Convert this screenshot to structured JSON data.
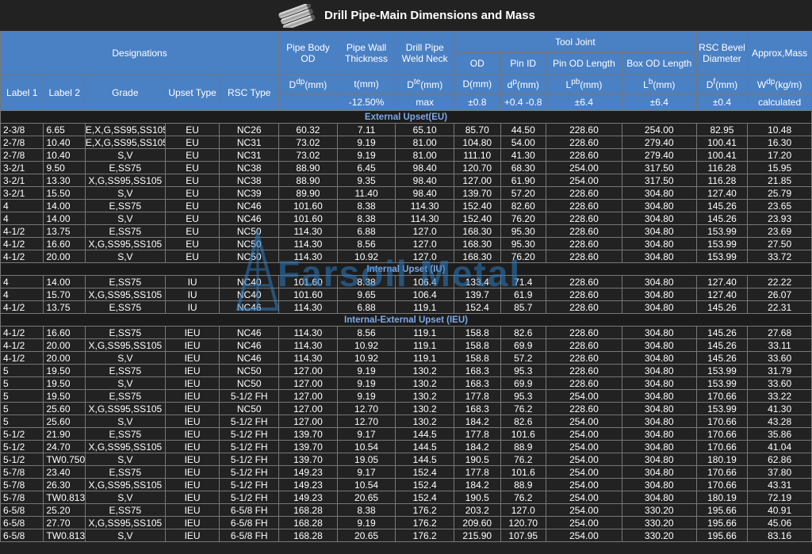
{
  "title": "Drill Pipe-Main Dimensions and Mass",
  "header": {
    "designations": "Designations",
    "pipe_body_od": "Pipe Body OD",
    "pipe_wall_thickness": "Pipe Wall Thickness",
    "drill_pipe_weld_neck": "Drill Pipe Weld Neck",
    "tool_joint": "Tool Joint",
    "rsc_bevel_diameter": "RSC Bevel Diameter",
    "approx_mass": "Approx,Mass",
    "od": "OD",
    "pin_id": "Pin ID",
    "pin_od_length": "Pin OD Length",
    "box_od_length": "Box OD Length",
    "label1": "Label 1",
    "label2": "Label 2",
    "grade": "Grade",
    "upset_type": "Upset Type",
    "rsc_type": "RSC Type",
    "u_ddp": "D<sup>dp</sup>(mm)",
    "u_t": "t(mm)",
    "u_dte": "D<sup>te</sup>(mm)",
    "u_d": "D(mm)",
    "u_dp": "d<sup>p</sup>(mm)",
    "u_lpb": "L<sup>pb</sup>(mm)",
    "u_lb": "L<sup>b</sup>(mm)",
    "u_df": "D<sup>f</sup>(mm)",
    "u_wdp": "W<sup>dp</sup>(kg/m)",
    "tol_t": "-12.50%",
    "tol_dte": "max",
    "tol_d": "±0.8",
    "tol_dp": "+0.4 -0.8",
    "tol_lpb": "±6.4",
    "tol_lb": "±6.4",
    "tol_df": "±0.4",
    "tol_w": "calculated"
  },
  "sections": [
    {
      "title": "External Upset(EU)",
      "rows": [
        [
          "2-3/8",
          "6.65",
          "E,X,G,SS95,SS105",
          "EU",
          "NC26",
          "60.32",
          "7.11",
          "65.10",
          "85.70",
          "44.50",
          "228.60",
          "254.00",
          "82.95",
          "10.48"
        ],
        [
          "2-7/8",
          "10.40",
          "E,X,G,SS95,SS105",
          "EU",
          "NC31",
          "73.02",
          "9.19",
          "81.00",
          "104.80",
          "54.00",
          "228.60",
          "279.40",
          "100.41",
          "16.30"
        ],
        [
          "2-7/8",
          "10.40",
          "S,V",
          "EU",
          "NC31",
          "73.02",
          "9.19",
          "81.00",
          "111.10",
          "41.30",
          "228.60",
          "279.40",
          "100.41",
          "17.20"
        ],
        [
          "3-2/1",
          "9.50",
          "E,SS75",
          "EU",
          "NC38",
          "88.90",
          "6.45",
          "98.40",
          "120.70",
          "68.30",
          "254.00",
          "317.50",
          "116.28",
          "15.95"
        ],
        [
          "3-2/1",
          "13.30",
          "X,G,SS95,SS105",
          "EU",
          "NC38",
          "88.90",
          "9.35",
          "98.40",
          "127.00",
          "61.90",
          "254.00",
          "317.50",
          "116.28",
          "21.85"
        ],
        [
          "3-2/1",
          "15.50",
          "S,V",
          "EU",
          "NC39",
          "89.90",
          "11.40",
          "98.40",
          "139.70",
          "57.20",
          "228.60",
          "304.80",
          "127.40",
          "25.79"
        ],
        [
          "4",
          "14.00",
          "E,SS75",
          "EU",
          "NC46",
          "101.60",
          "8.38",
          "114.30",
          "152.40",
          "82.60",
          "228.60",
          "304.80",
          "145.26",
          "23.65"
        ],
        [
          "4",
          "14.00",
          "S,V",
          "EU",
          "NC46",
          "101.60",
          "8.38",
          "114.30",
          "152.40",
          "76.20",
          "228.60",
          "304.80",
          "145.26",
          "23.93"
        ],
        [
          "4-1/2",
          "13.75",
          "E,SS75",
          "EU",
          "NC50",
          "114.30",
          "6.88",
          "127.0",
          "168.30",
          "95.30",
          "228.60",
          "304.80",
          "153.99",
          "23.69"
        ],
        [
          "4-1/2",
          "16.60",
          "X,G,SS95,SS105",
          "EU",
          "NC50",
          "114.30",
          "8.56",
          "127.0",
          "168.30",
          "95.30",
          "228.60",
          "304.80",
          "153.99",
          "27.50"
        ],
        [
          "4-1/2",
          "20.00",
          "S,V",
          "EU",
          "NC50",
          "114.30",
          "10.92",
          "127.0",
          "168.30",
          "76.20",
          "228.60",
          "304.80",
          "153.99",
          "33.72"
        ]
      ]
    },
    {
      "title": "Internal Upset (IU)",
      "rows": [
        [
          "4",
          "14.00",
          "E,SS75",
          "IU",
          "NC40",
          "101.60",
          "8.38",
          "106.4",
          "133.4",
          "71.4",
          "228.60",
          "304.80",
          "127.40",
          "22.22"
        ],
        [
          "4",
          "15.70",
          "X,G,SS95,SS105",
          "IU",
          "NC40",
          "101.60",
          "9.65",
          "106.4",
          "139.7",
          "61.9",
          "228.60",
          "304.80",
          "127.40",
          "26.07"
        ],
        [
          "4-1/2",
          "13.75",
          "E,SS75",
          "IU",
          "NC46",
          "114.30",
          "6.88",
          "119.1",
          "152.4",
          "85.7",
          "228.60",
          "304.80",
          "145.26",
          "22.31"
        ]
      ]
    },
    {
      "title": "Internal-External Upset (IEU)",
      "rows": [
        [
          "4-1/2",
          "16.60",
          "E,SS75",
          "IEU",
          "NC46",
          "114.30",
          "8.56",
          "119.1",
          "158.8",
          "82.6",
          "228.60",
          "304.80",
          "145.26",
          "27.68"
        ],
        [
          "4-1/2",
          "20.00",
          "X,G,SS95,SS105",
          "IEU",
          "NC46",
          "114.30",
          "10.92",
          "119.1",
          "158.8",
          "69.9",
          "228.60",
          "304.80",
          "145.26",
          "33.11"
        ],
        [
          "4-1/2",
          "20.00",
          "S,V",
          "IEU",
          "NC46",
          "114.30",
          "10.92",
          "119.1",
          "158.8",
          "57.2",
          "228.60",
          "304.80",
          "145.26",
          "33.60"
        ],
        [
          "5",
          "19.50",
          "E,SS75",
          "IEU",
          "NC50",
          "127.00",
          "9.19",
          "130.2",
          "168.3",
          "95.3",
          "228.60",
          "304.80",
          "153.99",
          "31.79"
        ],
        [
          "5",
          "19.50",
          "S,V",
          "IEU",
          "NC50",
          "127.00",
          "9.19",
          "130.2",
          "168.3",
          "69.9",
          "228.60",
          "304.80",
          "153.99",
          "33.60"
        ],
        [
          "5",
          "19.50",
          "E,SS75",
          "IEU",
          "5-1/2 FH",
          "127.00",
          "9.19",
          "130.2",
          "177.8",
          "95.3",
          "254.00",
          "304.80",
          "170.66",
          "33.22"
        ],
        [
          "5",
          "25.60",
          "X,G,SS95,SS105",
          "IEU",
          "NC50",
          "127.00",
          "12.70",
          "130.2",
          "168.3",
          "76.2",
          "228.60",
          "304.80",
          "153.99",
          "41.30"
        ],
        [
          "5",
          "25.60",
          "S,V",
          "IEU",
          "5-1/2 FH",
          "127.00",
          "12.70",
          "130.2",
          "184.2",
          "82.6",
          "254.00",
          "304.80",
          "170.66",
          "43.28"
        ],
        [
          "5-1/2",
          "21.90",
          "E,SS75",
          "IEU",
          "5-1/2 FH",
          "139.70",
          "9.17",
          "144.5",
          "177.8",
          "101.6",
          "254.00",
          "304.80",
          "170.66",
          "35.86"
        ],
        [
          "5-1/2",
          "24.70",
          "X,G,SS95,SS105",
          "IEU",
          "5-1/2 FH",
          "139.70",
          "10.54",
          "144.5",
          "184.2",
          "88.9",
          "254.00",
          "304.80",
          "170.66",
          "41.04"
        ],
        [
          "5-1/2",
          "TW0.750",
          "S,V",
          "IEU",
          "5-1/2 FH",
          "139.70",
          "19.05",
          "144.5",
          "190.5",
          "76.2",
          "254.00",
          "304.80",
          "180.19",
          "62.86"
        ],
        [
          "5-7/8",
          "23.40",
          "E,SS75",
          "IEU",
          "5-1/2 FH",
          "149.23",
          "9.17",
          "152.4",
          "177.8",
          "101.6",
          "254.00",
          "304.80",
          "170.66",
          "37.80"
        ],
        [
          "5-7/8",
          "26.30",
          "X,G,SS95,SS105",
          "IEU",
          "5-1/2 FH",
          "149.23",
          "10.54",
          "152.4",
          "184.2",
          "88.9",
          "254.00",
          "304.80",
          "170.66",
          "43.31"
        ],
        [
          "5-7/8",
          "TW0.813",
          "S,V",
          "IEU",
          "5-1/2 FH",
          "149.23",
          "20.65",
          "152.4",
          "190.5",
          "76.2",
          "254.00",
          "304.80",
          "180.19",
          "72.19"
        ],
        [
          "6-5/8",
          "25.20",
          "E,SS75",
          "IEU",
          "6-5/8 FH",
          "168.28",
          "8.38",
          "176.2",
          "203.2",
          "127.0",
          "254.00",
          "330.20",
          "195.66",
          "40.91"
        ],
        [
          "6-5/8",
          "27.70",
          "X,G,SS95,SS105",
          "IEU",
          "6-5/8 FH",
          "168.28",
          "9.19",
          "176.2",
          "209.60",
          "120.70",
          "254.00",
          "330.20",
          "195.66",
          "45.06"
        ],
        [
          "6-5/8",
          "TW0.813",
          "S,V",
          "IEU",
          "6-5/8 FH",
          "168.28",
          "20.65",
          "176.2",
          "215.90",
          "107.95",
          "254.00",
          "330.20",
          "195.66",
          "83.16"
        ]
      ]
    }
  ],
  "watermark": "Farsoil Metal",
  "colors": {
    "header_bg": "#4a80c4",
    "page_bg": "#222222",
    "section_text": "#7ea9e8",
    "watermark": "#2e7bc0"
  }
}
